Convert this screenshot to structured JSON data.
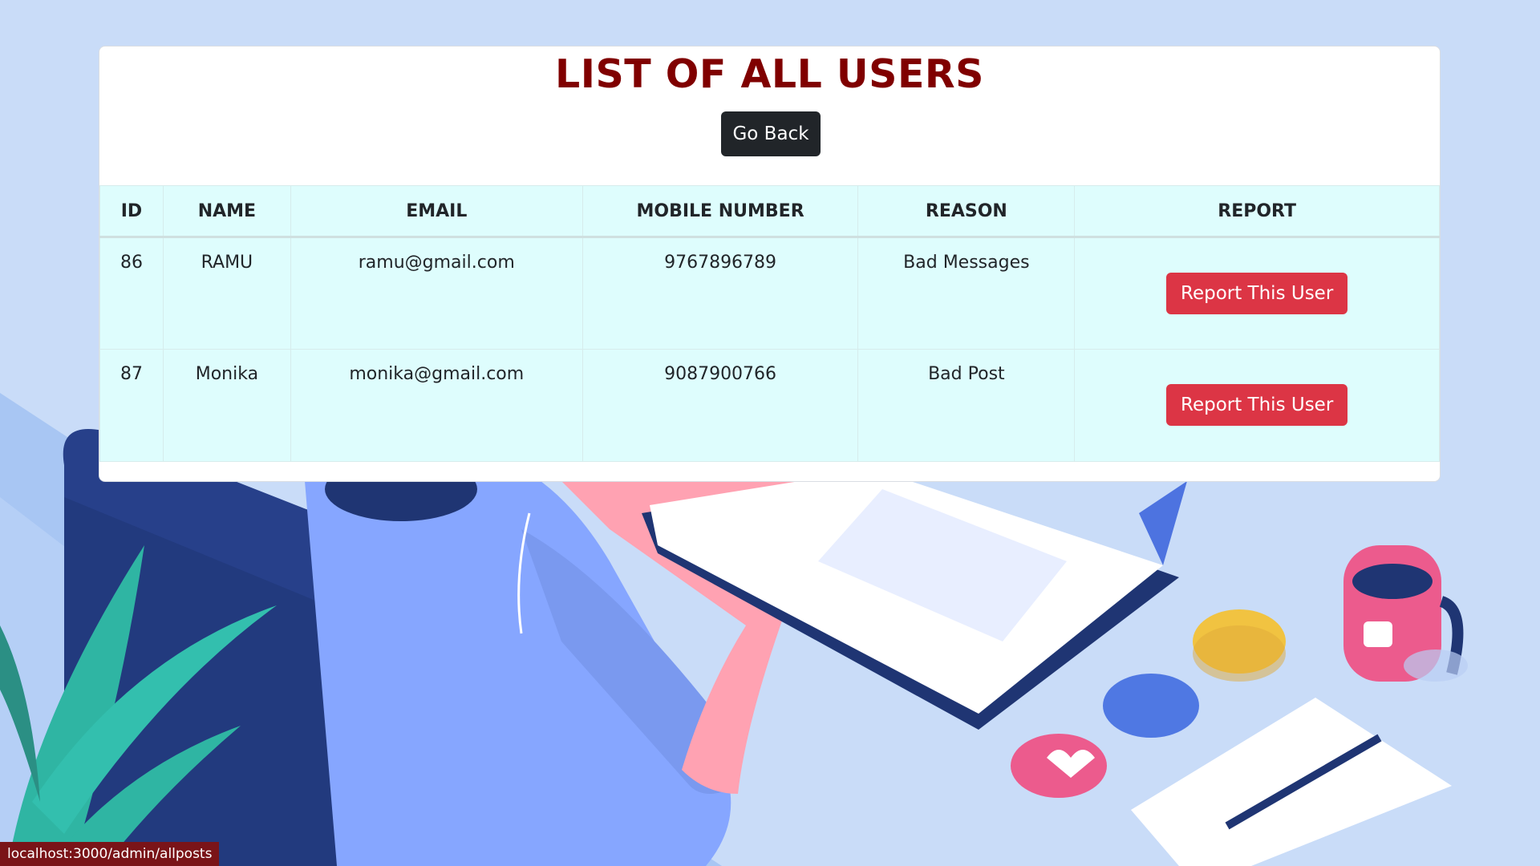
{
  "page": {
    "title": "LIST OF ALL USERS",
    "go_back_label": "Go Back"
  },
  "table": {
    "headers": [
      "ID",
      "NAME",
      "EMAIL",
      "MOBILE NUMBER",
      "REASON",
      "REPORT"
    ],
    "rows": [
      {
        "id": "86",
        "name": "RAMU",
        "email": "ramu@gmail.com",
        "mobile": "9767896789",
        "reason": "Bad Messages",
        "action": "Report This User"
      },
      {
        "id": "87",
        "name": "Monika",
        "email": "monika@gmail.com",
        "mobile": "9087900766",
        "reason": "Bad Post",
        "action": "Report This User"
      }
    ]
  },
  "status_bar": {
    "url": "localhost:3000/admin/allposts"
  },
  "colors": {
    "title": "#800000",
    "go_back_bg": "#212529",
    "report_button_bg": "#dc3545",
    "table_bg": "#defdfd",
    "page_bg": "#c9dcf8"
  },
  "icons": [
    "workspace-illustration"
  ]
}
